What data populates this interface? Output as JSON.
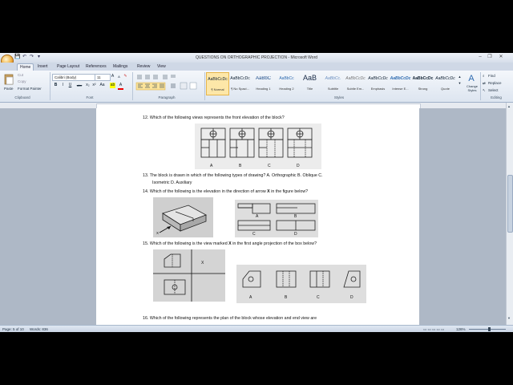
{
  "window": {
    "title": "QUESTIONS ON ORTHOGRAPHIC PROJECTION - Microsoft Word"
  },
  "quick_access": {
    "save_glyph": "💾",
    "undo_glyph": "↶",
    "redo_glyph": "↷",
    "more_glyph": "▾"
  },
  "window_controls": {
    "minimize": "–",
    "restore": "❐",
    "close": "✕"
  },
  "tabs": [
    "Home",
    "Insert",
    "Page Layout",
    "References",
    "Mailings",
    "Review",
    "View"
  ],
  "clipboard": {
    "paste": "Paste",
    "cut": "Cut",
    "copy": "Copy",
    "format_painter": "Format Painter",
    "label": "Clipboard"
  },
  "font": {
    "name": "Calibri (Body)",
    "size": "11",
    "label": "Font",
    "bold": "B",
    "italic": "I",
    "underline": "U",
    "strike": "abc",
    "sub": "x₂",
    "sup": "x²",
    "aa": "Aa",
    "color": "A"
  },
  "paragraph": {
    "label": "Paragraph"
  },
  "styles": {
    "label": "Styles",
    "items": [
      {
        "preview": "AaBbCcDc",
        "name": "¶ Normal"
      },
      {
        "preview": "AaBbCcDc",
        "name": "¶ No Spaci..."
      },
      {
        "preview": "AaBbC",
        "name": "Heading 1"
      },
      {
        "preview": "AaBbCc",
        "name": "Heading 2"
      },
      {
        "preview": "AaB",
        "name": "Title"
      },
      {
        "preview": "AaBbCc.",
        "name": "Subtitle"
      },
      {
        "preview": "AaBbCcDc",
        "name": "Subtle Em..."
      },
      {
        "preview": "AaBbCcDc",
        "name": "Emphasis"
      },
      {
        "preview": "AaBbCcDc",
        "name": "Intense E..."
      },
      {
        "preview": "AaBbCcDc",
        "name": "Strong"
      },
      {
        "preview": "AaBbCcDc",
        "name": "Quote"
      }
    ],
    "change_styles": "Change Styles"
  },
  "editing": {
    "find": "Find",
    "replace": "Replace",
    "select": "Select",
    "label": "Editing"
  },
  "document": {
    "q12": "12.  Which of the following views represents  the front elevation of the block?",
    "q12_labels": [
      "A",
      "B",
      "C",
      "D"
    ],
    "q13_line1": "13.  The block is drawn in which of the following types of drawing? A. Orthographic B. Oblique  C.",
    "q13_line2": "Isometric D. Auxiliary",
    "q14_pre": "14.  Which of the following is the elevation in the direction of arrow ",
    "q14_bold": "X",
    "q14_post": " in the figure below?",
    "q14_labels": [
      "A",
      "B",
      "C",
      "D"
    ],
    "q14_arrow": "X",
    "q15_pre": "15.  Which of the following is the view marked ",
    "q15_bold": "X",
    "q15_post": " in the first angle projection of the box below?",
    "q15_x": "X",
    "q15_labels": [
      "A",
      "B",
      "C",
      "D"
    ],
    "q16": "16.  Which of the following represents  the plan of the block whose elevation and end view are"
  },
  "status": {
    "page": "Page: 5 of 10",
    "words": "Words: 836",
    "zoom": "126%"
  }
}
